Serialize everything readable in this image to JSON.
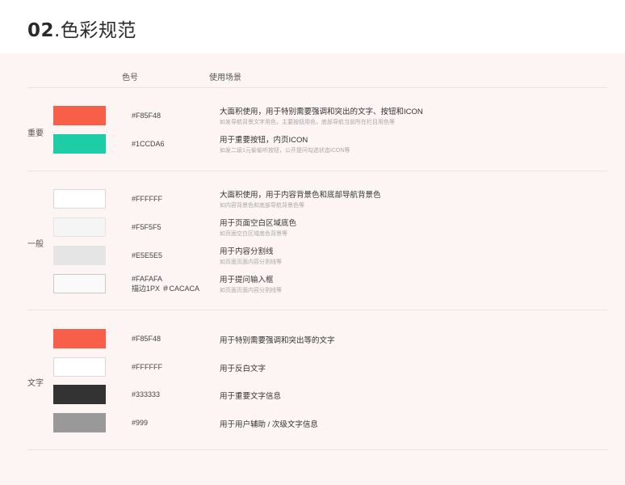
{
  "title": {
    "number": "02",
    "text": ".色彩规范"
  },
  "headers": {
    "code": "色号",
    "usage": "使用场景"
  },
  "groups": [
    {
      "label": "重要",
      "rows": [
        {
          "color": "#F85F48",
          "border": "",
          "code": "#F85F48",
          "code2": "",
          "desc": "大面积使用，用于特别需要强调和突出的文字、按钮和ICON",
          "sub": "如发导航背景文字用色，主要按钮用色，底部导航当前所在栏目用色等"
        },
        {
          "color": "#1CCDA6",
          "border": "",
          "code": "#1CCDA6",
          "code2": "",
          "desc": "用于重要按钮，内页ICON",
          "sub": "如发二级1元偷偷听按钮，公开提问勾选状态ICON等"
        }
      ]
    },
    {
      "label": "一般",
      "rows": [
        {
          "color": "#FFFFFF",
          "border": "#D9D9D9",
          "code": "#FFFFFF",
          "code2": "",
          "desc": "大面积使用，用于内容背景色和底部导航背景色",
          "sub": "如内容背景色和底部导航背景色等"
        },
        {
          "color": "#F5F5F5",
          "border": "#E5E5E5",
          "code": "#F5F5F5",
          "code2": "",
          "desc": "用于页面空白区域底色",
          "sub": "如页面空白区域底色背景等"
        },
        {
          "color": "#E5E5E5",
          "border": "",
          "code": "#E5E5E5",
          "code2": "",
          "desc": "用于内容分割线",
          "sub": "如页面页面内容分割线等"
        },
        {
          "color": "#FAFAFA",
          "border": "#CACACA",
          "code": "#FAFAFA",
          "code2": "描边1PX ＃CACACA",
          "desc": "用于提问输入框",
          "sub": "如页面页面内容分割线等"
        }
      ]
    },
    {
      "label": "文字",
      "rows": [
        {
          "color": "#F85F48",
          "border": "",
          "code": "#F85F48",
          "code2": "",
          "desc": "用于特别需要强调和突出等的文字",
          "sub": ""
        },
        {
          "color": "#FFFFFF",
          "border": "#D9D9D9",
          "code": "#FFFFFF",
          "code2": "",
          "desc": "用于反白文字",
          "sub": ""
        },
        {
          "color": "#333333",
          "border": "",
          "code": "#333333",
          "code2": "",
          "desc": "用于重要文字信息",
          "sub": ""
        },
        {
          "color": "#999999",
          "border": "",
          "code": "#999",
          "code2": "",
          "desc": "用于用户辅助 / 次级文字信息",
          "sub": ""
        }
      ]
    }
  ]
}
